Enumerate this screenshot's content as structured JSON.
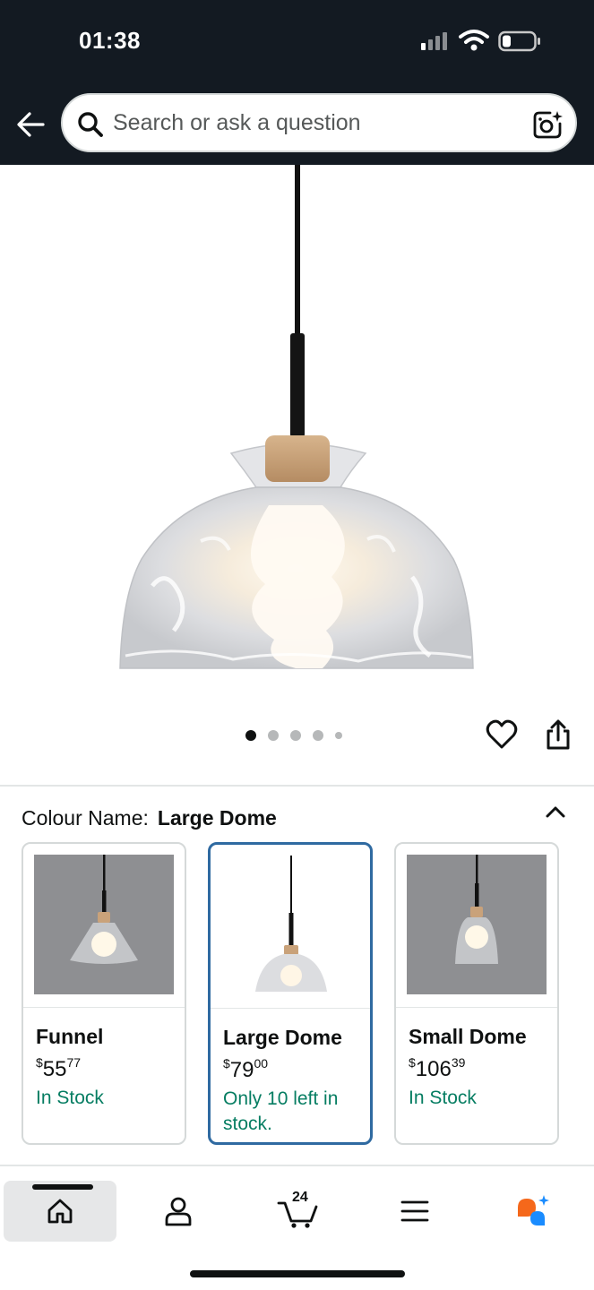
{
  "status_bar": {
    "time": "01:38"
  },
  "search": {
    "placeholder": "Search or ask a question"
  },
  "gallery": {
    "image_count": 5,
    "active_index": 0
  },
  "colour": {
    "label": "Colour Name:",
    "selected": "Large Dome",
    "options": [
      {
        "name": "Funnel",
        "price_symbol": "$",
        "price_whole": "55",
        "price_fraction": "77",
        "stock": "In Stock"
      },
      {
        "name": "Large Dome",
        "price_symbol": "$",
        "price_whole": "79",
        "price_fraction": "00",
        "stock": "Only 10 left in stock."
      },
      {
        "name": "Small Dome",
        "price_symbol": "$",
        "price_whole": "106",
        "price_fraction": "39",
        "stock": "In Stock"
      }
    ]
  },
  "nav": {
    "cart_count": "24",
    "active": "home"
  },
  "colors": {
    "header_bg": "#131a22",
    "selected_border": "#2f6aa1",
    "stock_green": "#067d62",
    "assistant_orange": "#f5681b",
    "assistant_blue": "#1a8cff"
  },
  "icons": [
    "back-arrow-icon",
    "search-icon",
    "camera-icon",
    "heart-icon",
    "share-icon",
    "chevron-up-icon",
    "home-icon",
    "account-icon",
    "cart-icon",
    "menu-icon",
    "assistant-icon"
  ]
}
